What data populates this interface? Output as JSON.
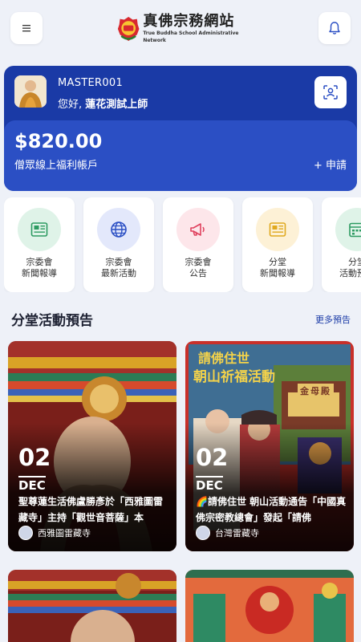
{
  "header": {
    "logo_title": "真佛宗務網站",
    "logo_subtitle": "True Buddha School Administrative Network",
    "menu_icon": "menu-icon",
    "bell_icon": "bell-icon"
  },
  "account": {
    "user_id": "MASTER001",
    "greeting_prefix": "您好,",
    "greeting_name": "蓮花測試上師",
    "balance": "$820.00",
    "balance_label": "僧眾線上福利帳戶",
    "apply_label": "+ 申請",
    "colors": {
      "card": "#1a3aa6",
      "panel": "#2b4fc4"
    }
  },
  "tiles": [
    {
      "label": "宗委會\n新聞報導",
      "icon": "newspaper-icon",
      "bg": "#dff3e8",
      "fg": "#2e9b62"
    },
    {
      "label": "宗委會\n最新活動",
      "icon": "globe-icon",
      "bg": "#e3e8fb",
      "fg": "#2b4fc4"
    },
    {
      "label": "宗委會\n公告",
      "icon": "megaphone-icon",
      "bg": "#fde6ea",
      "fg": "#e0415e"
    },
    {
      "label": "分堂\n新聞報導",
      "icon": "newspaper-icon",
      "bg": "#fdf1d6",
      "fg": "#e0a91f"
    },
    {
      "label": "分堂\n活動預告",
      "icon": "calendar-icon",
      "bg": "#dff3e8",
      "fg": "#2e9b62"
    }
  ],
  "section": {
    "title": "分堂活動預告",
    "more": "更多預告"
  },
  "events": [
    {
      "day": "02",
      "month": "DEC",
      "title": "聖尊蓮生活佛盧勝彥於「西雅圖雷藏寺」主持「觀世音菩薩」本",
      "org": "西雅圖雷藏寺"
    },
    {
      "day": "02",
      "month": "DEC",
      "title": "🌈請佛住世 朝山活動通告「中國真佛宗密教總會」發起「請佛",
      "org": "台灣雷藏寺",
      "poster_line1": "請佛住世",
      "poster_line2": "朝山祈福活動",
      "poster_sign": "金母殿"
    },
    {
      "day": "",
      "month": "",
      "title": "",
      "org": ""
    },
    {
      "day": "",
      "month": "",
      "title": "",
      "org": ""
    }
  ]
}
